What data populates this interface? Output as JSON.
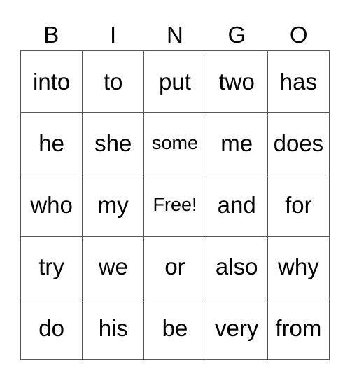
{
  "header": [
    "B",
    "I",
    "N",
    "G",
    "O"
  ],
  "rows": [
    [
      "into",
      "to",
      "put",
      "two",
      "has"
    ],
    [
      "he",
      "she",
      "some",
      "me",
      "does"
    ],
    [
      "who",
      "my",
      "Free!",
      "and",
      "for"
    ],
    [
      "try",
      "we",
      "or",
      "also",
      "why"
    ],
    [
      "do",
      "his",
      "be",
      "very",
      "from"
    ]
  ]
}
